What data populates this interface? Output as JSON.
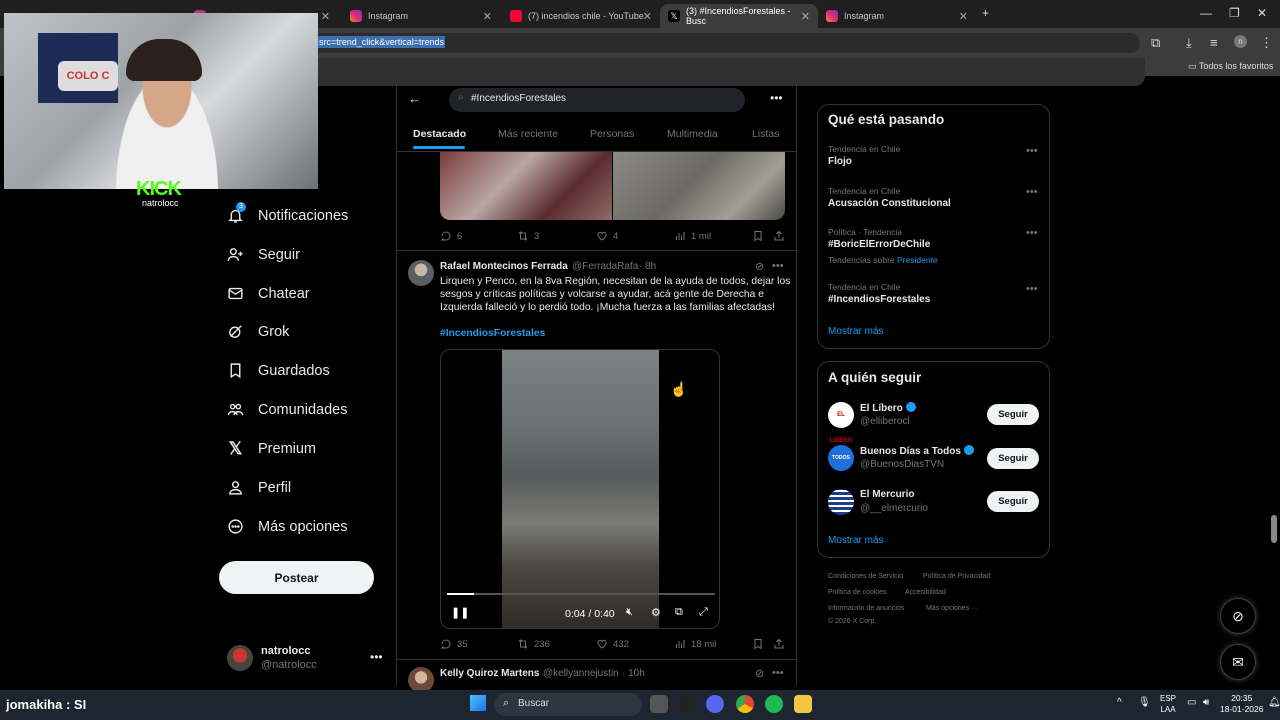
{
  "browser": {
    "tabs": [
      {
        "label": "",
        "active": false
      },
      {
        "label": "Instagram",
        "active": false
      },
      {
        "label": "(7) incendios chile - YouTube",
        "active": false
      },
      {
        "label": "(3) #IncendiosForestales - Busc",
        "active": true
      },
      {
        "label": "Instagram",
        "active": false
      }
    ],
    "url_fragment": "src=trend_click&vertical=trends",
    "bookmarks_label": "Todos los favoritos"
  },
  "stream": {
    "kick_logo": "KICK",
    "streamer_name": "natrolocc",
    "crest_text": "COLO C"
  },
  "nav": {
    "items": [
      {
        "label": "Notificaciones",
        "icon": "bell-icon"
      },
      {
        "label": "Seguir",
        "icon": "person-add-icon"
      },
      {
        "label": "Chatear",
        "icon": "mail-icon"
      },
      {
        "label": "Grok",
        "icon": "grok-icon"
      },
      {
        "label": "Guardados",
        "icon": "bookmark-icon"
      },
      {
        "label": "Comunidades",
        "icon": "people-icon"
      },
      {
        "label": "Premium",
        "icon": "x-logo-icon"
      },
      {
        "label": "Perfil",
        "icon": "profile-icon"
      },
      {
        "label": "Más opciones",
        "icon": "more-circle-icon"
      }
    ],
    "notification_badge": "3",
    "post_button": "Postear",
    "account": {
      "name": "natrolocc",
      "handle": "@natrolocc"
    }
  },
  "search": {
    "query": "#IncendiosForestales",
    "tabs": [
      "Destacado",
      "Más reciente",
      "Personas",
      "Multimedia",
      "Listas"
    ],
    "active_tab": "Destacado"
  },
  "tweets": [
    {
      "actions": {
        "replies": "6",
        "reposts": "3",
        "likes": "4",
        "views": "1 mil"
      }
    },
    {
      "name": "Rafael Montecinos Ferrada",
      "handle": "@FerradaRafa",
      "time": "· 8h",
      "text_lines": [
        "Lirquen y Penco, en la 8va Región, necesitan de la ayuda de todos, dejar los",
        "sesgos y críticas políticas y volcarse a ayudar, acá gente de Derecha e",
        "Izquierda falleció y lo perdió todo. ¡Mucha fuerza a las familias afectadas!"
      ],
      "hashtag": "#IncendiosForestales",
      "video": {
        "time": "0:04 / 0:40",
        "progress": 0.1
      },
      "actions": {
        "replies": "35",
        "reposts": "236",
        "likes": "432",
        "views": "18 mil"
      }
    },
    {
      "name": "Kelly Quiroz Martens",
      "handle": "@kellyannejustin",
      "time": "· 10h"
    }
  ],
  "trends": {
    "title": "Qué está pasando",
    "items": [
      {
        "context": "Tendencia en Chile",
        "name": "Flojo",
        "extra": ""
      },
      {
        "context": "Tendencia en Chile",
        "name": "Acusación Constitucional",
        "extra": ""
      },
      {
        "context": "Política · Tendencia",
        "name": "#BoricElErrorDeChile",
        "extra": "Tendencias sobre",
        "extra_link": "Presidente"
      },
      {
        "context": "Tendencia en Chile",
        "name": "#IncendiosForestales",
        "extra": ""
      }
    ],
    "show_more": "Mostrar más"
  },
  "who_to_follow": {
    "title": "A quién seguir",
    "items": [
      {
        "name": "El Líbero",
        "handle": "@elliberocl",
        "verified": true,
        "button": "Seguir"
      },
      {
        "name": "Buenos Días a Todos",
        "handle": "@BuenosDiasTVN",
        "verified": true,
        "button": "Seguir"
      },
      {
        "name": "El Mercurio",
        "handle": "@__elmercurio",
        "verified": false,
        "button": "Seguir"
      }
    ],
    "show_more": "Mostrar más"
  },
  "footer": {
    "links": [
      "Condiciones de Servicio",
      "Política de Privacidad",
      "Política de cookies",
      "Accesibilidad",
      "Información de anuncios",
      "Más opciones ···"
    ],
    "copyright": "© 2026 X Corp."
  },
  "taskbar": {
    "chat_overlay": "jomakiha : SI",
    "search_placeholder": "Buscar",
    "lang_line1": "ESP",
    "lang_line2": "LAA",
    "time": "20:35",
    "date": "18-01-2026"
  },
  "colors": {
    "accent": "#1d9bf0",
    "background": "#000000",
    "kick_green": "#53fc18"
  }
}
